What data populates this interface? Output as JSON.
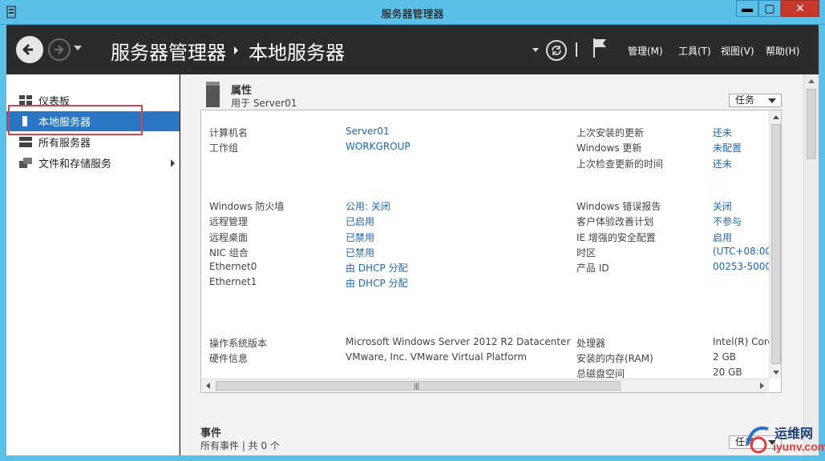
{
  "window": {
    "title": "服务器管理器",
    "min_label": "▬",
    "max_label": "▢",
    "close_label": "✕",
    "titlebar_color": "#5bc0e8"
  },
  "header": {
    "breadcrumb_root": "服务器管理器",
    "breadcrumb_current": "本地服务器",
    "menu": {
      "manage": "管理(M)",
      "tools": "工具(T)",
      "view": "视图(V)",
      "help": "帮助(H)"
    },
    "icons": [
      "back-icon",
      "forward-icon",
      "refresh-icon",
      "flag-icon"
    ]
  },
  "sidebar": {
    "items": [
      {
        "label": "仪表板",
        "icon": "dashboard-icon"
      },
      {
        "label": "本地服务器",
        "icon": "local-server-icon",
        "selected": true
      },
      {
        "label": "所有服务器",
        "icon": "all-servers-icon"
      },
      {
        "label": "文件和存储服务",
        "icon": "file-storage-icon"
      }
    ],
    "selected_color": "#2a76c4"
  },
  "properties": {
    "title": "属性",
    "subtitle": "用于 Server01",
    "tasks_label": "任务",
    "left_rows": [
      {
        "label": "计算机名",
        "value": "Server01"
      },
      {
        "label": "工作组",
        "value": "WORKGROUP"
      },
      {
        "label": "Windows 防火墙",
        "value": "公用: 关闭"
      },
      {
        "label": "远程管理",
        "value": "已启用"
      },
      {
        "label": "远程桌面",
        "value": "已禁用"
      },
      {
        "label": "NIC 组合",
        "value": "已禁用"
      },
      {
        "label": "Ethernet0",
        "value": "由 DHCP 分配"
      },
      {
        "label": "Ethernet1",
        "value": "由 DHCP 分配"
      },
      {
        "label": "操作系统版本",
        "value": "Microsoft Windows Server 2012 R2 Datacenter"
      },
      {
        "label": "硬件信息",
        "value": "VMware, Inc. VMware Virtual Platform"
      }
    ],
    "right_rows": [
      {
        "label": "上次安装的更新",
        "value": "还未"
      },
      {
        "label": "Windows 更新",
        "value": "未配置"
      },
      {
        "label": "上次检查更新的时间",
        "value": "还未"
      },
      {
        "label": "Windows 错误报告",
        "value": "关闭"
      },
      {
        "label": "客户体验改善计划",
        "value": "不参与"
      },
      {
        "label": "IE 增强的安全配置",
        "value": "启用"
      },
      {
        "label": "时区",
        "value": "(UTC+08:00"
      },
      {
        "label": "产品 ID",
        "value": "00253-5000"
      },
      {
        "label": "处理器",
        "value": "Intel(R) Core"
      },
      {
        "label": "安装的内存(RAM)",
        "value": "2 GB"
      },
      {
        "label": "总磁盘空间",
        "value": "20 GB"
      }
    ]
  },
  "events": {
    "title": "事件",
    "subtitle": "所有事件 | 共 0 个",
    "tasks_label": "任务"
  },
  "watermark": {
    "line1": "运维网",
    "line2": "iyunv.com"
  }
}
